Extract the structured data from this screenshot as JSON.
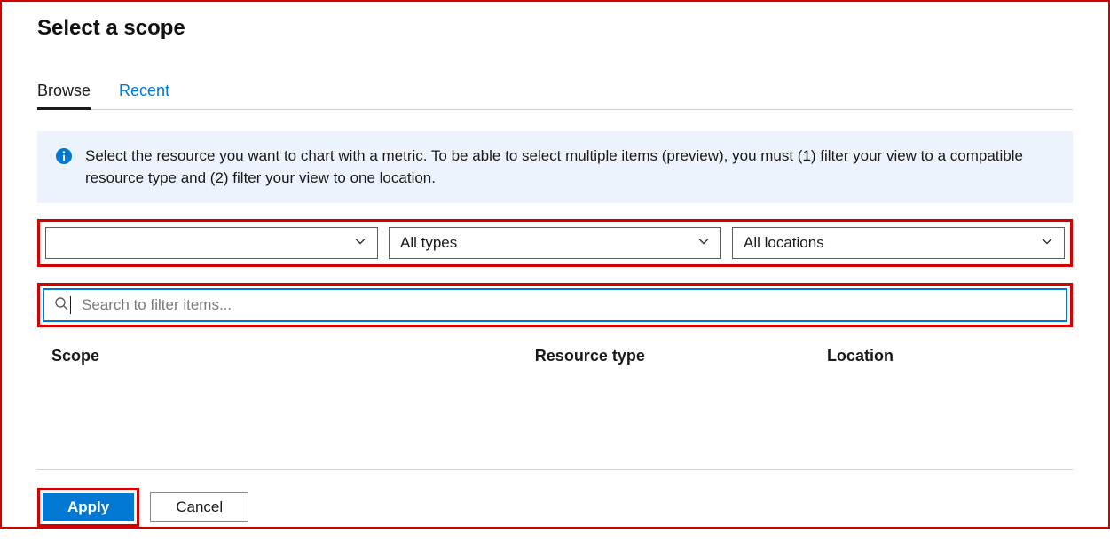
{
  "dialog": {
    "title": "Select a scope"
  },
  "tabs": {
    "browse": "Browse",
    "recent": "Recent",
    "active": "browse"
  },
  "info": {
    "text": "Select the resource you want to chart with a metric. To be able to select multiple items (preview), you must (1) filter your view to a compatible resource type and (2) filter your view to one location."
  },
  "filters": {
    "subscription": {
      "value": ""
    },
    "type": {
      "value": "All types"
    },
    "location": {
      "value": "All locations"
    }
  },
  "search": {
    "placeholder": "Search to filter items...",
    "value": ""
  },
  "table": {
    "headers": {
      "scope": "Scope",
      "resource_type": "Resource type",
      "location": "Location"
    }
  },
  "footer": {
    "apply": "Apply",
    "cancel": "Cancel"
  },
  "colors": {
    "accent": "#0078d4",
    "highlight_border": "#d40000",
    "info_bg": "#ecf3fc"
  }
}
